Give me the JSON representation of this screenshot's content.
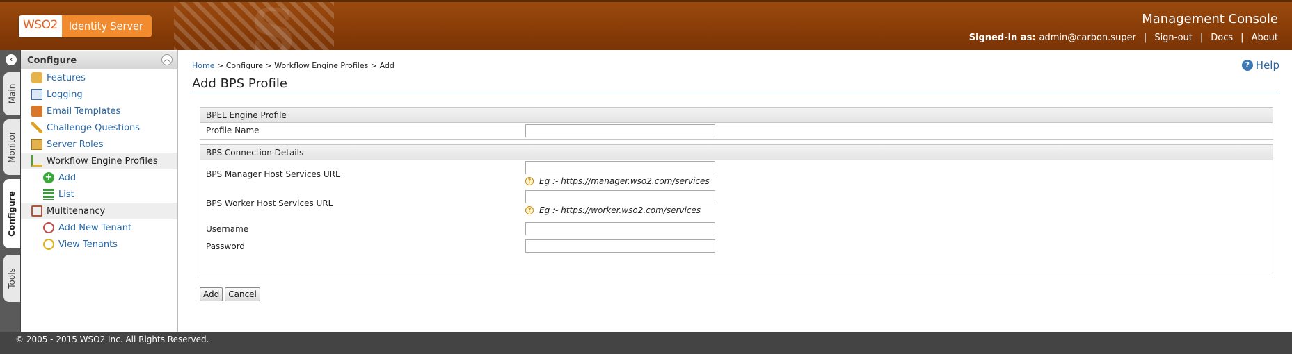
{
  "header": {
    "logo_brand": "WSO2",
    "logo_product": "Identity Server",
    "console_title": "Management Console",
    "signed_in_label": "Signed-in as:",
    "signed_in_user": "admin@carbon.super",
    "links": [
      "Sign-out",
      "Docs",
      "About"
    ]
  },
  "vtabs": [
    "Main",
    "Monitor",
    "Configure",
    "Tools"
  ],
  "sidebar": {
    "title": "Configure",
    "items": [
      {
        "label": "Features",
        "icon": "features-icon"
      },
      {
        "label": "Logging",
        "icon": "logging-icon"
      },
      {
        "label": "Email Templates",
        "icon": "email-templates-icon"
      },
      {
        "label": "Challenge Questions",
        "icon": "challenge-questions-icon"
      },
      {
        "label": "Server Roles",
        "icon": "server-roles-icon"
      },
      {
        "label": "Workflow Engine Profiles",
        "icon": "workflow-icon"
      },
      {
        "label": "Add",
        "icon": "add-icon"
      },
      {
        "label": "List",
        "icon": "list-icon"
      },
      {
        "label": "Multitenancy",
        "icon": "multitenancy-icon"
      },
      {
        "label": "Add New Tenant",
        "icon": "add-tenant-icon"
      },
      {
        "label": "View Tenants",
        "icon": "view-tenants-icon"
      }
    ]
  },
  "breadcrumb": {
    "home": "Home",
    "rest": "> Configure > Workflow Engine Profiles > Add"
  },
  "help": "Help",
  "page_title": "Add BPS Profile",
  "form": {
    "profile_section": "BPEL Engine Profile",
    "profile_name_label": "Profile Name",
    "profile_name_value": "",
    "conn_section": "BPS Connection Details",
    "manager_label": "BPS Manager Host Services URL",
    "manager_value": "",
    "manager_hint": "Eg :- https://manager.wso2.com/services",
    "worker_label": "BPS Worker Host Services URL",
    "worker_value": "",
    "worker_hint": "Eg :- https://worker.wso2.com/services",
    "username_label": "Username",
    "username_value": "",
    "password_label": "Password",
    "password_value": ""
  },
  "buttons": {
    "add": "Add",
    "cancel": "Cancel"
  },
  "footer": "© 2005 - 2015 WSO2 Inc. All Rights Reserved."
}
